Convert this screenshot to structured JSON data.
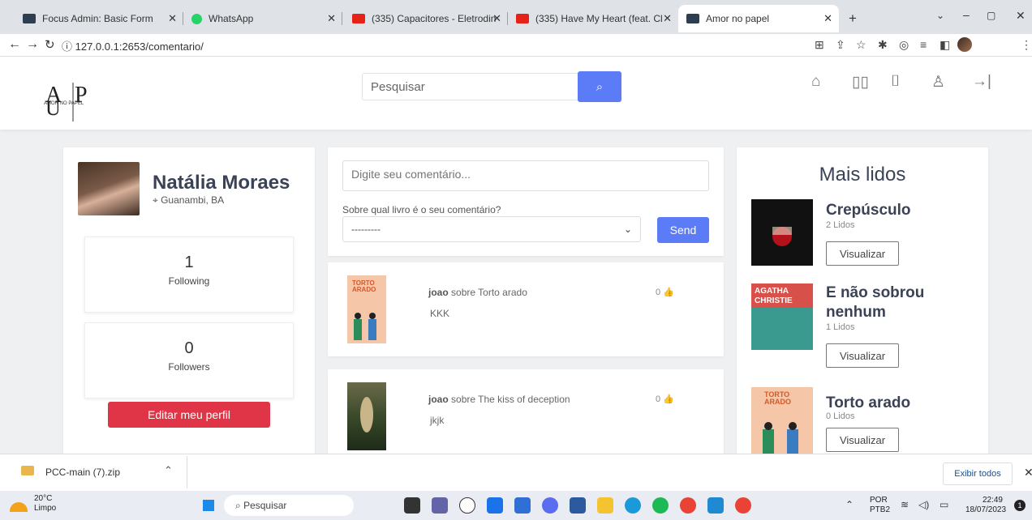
{
  "browser": {
    "tabs": [
      {
        "label": "Focus Admin: Basic Form",
        "color": "#2d3e50"
      },
      {
        "label": "WhatsApp",
        "color": "#25d366"
      },
      {
        "label": "(335) Capacitores - Eletrodin",
        "color": "#e62117"
      },
      {
        "label": "(335) Have My Heart (feat. Cl",
        "color": "#e62117"
      },
      {
        "label": "Amor no papel",
        "color": "#2d3e50"
      }
    ],
    "url": "127.0.0.1:2653/comentario/"
  },
  "site": {
    "logo_text": "AMOR NO PAPEL",
    "logo_letters": "AP",
    "search_placeholder": "Pesquisar",
    "header_icons": [
      "home-icon",
      "book-icon",
      "bookmark-icon",
      "user-icon",
      "logout-icon"
    ]
  },
  "profile": {
    "name": "Natália Moraes",
    "location": "Guanambi, BA",
    "following_count": "1",
    "following_label": "Following",
    "followers_count": "0",
    "followers_label": "Followers",
    "edit_label": "Editar meu perfil"
  },
  "composer": {
    "placeholder": "Digite seu comentário...",
    "book_question": "Sobre qual livro é o seu comentário?",
    "book_selected": "---------",
    "send_label": "Send"
  },
  "posts": [
    {
      "user": "joao",
      "connector": "sobre",
      "book": "Torto arado",
      "likes": "0",
      "text": "KKK"
    },
    {
      "user": "joao",
      "connector": "sobre",
      "book": "The kiss of deception",
      "likes": "0",
      "text": "jkjk"
    }
  ],
  "popular": {
    "title": "Mais lidos",
    "items": [
      {
        "title": "Crepúsculo",
        "reads": "2 Lidos",
        "button": "Visualizar"
      },
      {
        "title": "E não sobrou nenhum",
        "reads": "1 Lidos",
        "button": "Visualizar"
      },
      {
        "title": "Torto arado",
        "reads": "0 Lidos",
        "button": "Visualizar"
      }
    ]
  },
  "downloads": {
    "file": "PCC-main (7).zip",
    "show_all": "Exibir todos"
  },
  "taskbar": {
    "temp": "20°C",
    "weather": "Limpo",
    "search": "Pesquisar",
    "lang1": "POR",
    "lang2": "PTB2",
    "time": "22:49",
    "date": "18/07/2023",
    "notifications": "1"
  }
}
